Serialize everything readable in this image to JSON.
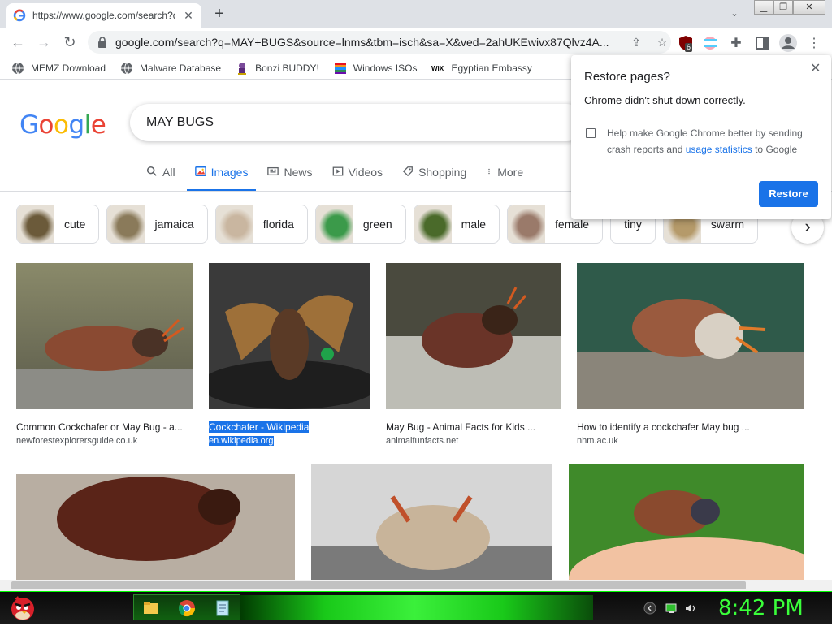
{
  "browser": {
    "tab": {
      "title": "https://www.google.com/search?q=MAY+BUGS",
      "close_label": "✕"
    },
    "new_tab_label": "+",
    "tab_menu_label": "⌄",
    "window_buttons": {
      "minimize": "▁",
      "restore": "❐",
      "close": "✕"
    },
    "nav": {
      "back": "←",
      "forward": "→",
      "reload": "↻"
    },
    "url": "google.com/search?q=MAY+BUGS&source=lnms&tbm=isch&sa=X&ved=2ahUKEwivx87Qlvz4A...",
    "extension_badge": "6"
  },
  "bookmarks": [
    {
      "label": "MEMZ Download",
      "icon": "globe-icon"
    },
    {
      "label": "Malware Database",
      "icon": "globe-icon"
    },
    {
      "label": "Bonzi BUDDY!",
      "icon": "bonzi-icon"
    },
    {
      "label": "Windows ISOs",
      "icon": "windows-flag-icon"
    },
    {
      "label": "Egyptian Embassy",
      "icon": "wix-icon"
    }
  ],
  "google": {
    "logo": [
      "G",
      "o",
      "o",
      "g",
      "l",
      "e"
    ],
    "logo_colors": [
      "#4285f4",
      "#ea4335",
      "#fbbc05",
      "#4285f4",
      "#34a853",
      "#ea4335"
    ],
    "query": "MAY BUGS",
    "tabs": [
      {
        "label": "All",
        "icon": "search-icon",
        "active": false
      },
      {
        "label": "Images",
        "icon": "image-icon",
        "active": true
      },
      {
        "label": "News",
        "icon": "news-icon",
        "active": false
      },
      {
        "label": "Videos",
        "icon": "play-icon",
        "active": false
      },
      {
        "label": "Shopping",
        "icon": "tag-icon",
        "active": false
      },
      {
        "label": "More",
        "icon": "kebab-icon",
        "active": false
      }
    ],
    "chips": [
      {
        "label": "cute",
        "thumb": "#6b5a3a"
      },
      {
        "label": "jamaica",
        "thumb": "#8a7a5a"
      },
      {
        "label": "florida",
        "thumb": "#c9b6a0"
      },
      {
        "label": "green",
        "thumb": "#3b9a4a"
      },
      {
        "label": "male",
        "thumb": "#4a6a2a"
      },
      {
        "label": "female",
        "thumb": "#9a7a6a"
      },
      {
        "label": "tiny",
        "thumb": ""
      },
      {
        "label": "swarm",
        "thumb": "#b59a6a"
      }
    ],
    "chip_next": "›"
  },
  "results": [
    {
      "title": "Common Cockchafer or May Bug - a...",
      "source": "newforestexplorersguide.co.uk",
      "selected": false
    },
    {
      "title": "Cockchafer - Wikipedia",
      "source": "en.wikipedia.org",
      "selected": true
    },
    {
      "title": "May Bug - Animal Facts for Kids ...",
      "source": "animalfunfacts.net",
      "selected": false
    },
    {
      "title": "How to identify a cockchafer May bug ...",
      "source": "nhm.ac.uk",
      "selected": false
    }
  ],
  "popup": {
    "title": "Restore pages?",
    "subtitle": "Chrome didn't shut down correctly.",
    "checkbox_text_pre": "Help make Google Chrome better by sending crash reports and ",
    "checkbox_link": "usage statistics",
    "checkbox_text_post": " to Google",
    "close_label": "✕",
    "button": "Restore"
  },
  "taskbar": {
    "clock": "8:42 PM"
  },
  "colors": {
    "accent": "#1a73e8",
    "taskbar_green": "#3aff3a"
  }
}
